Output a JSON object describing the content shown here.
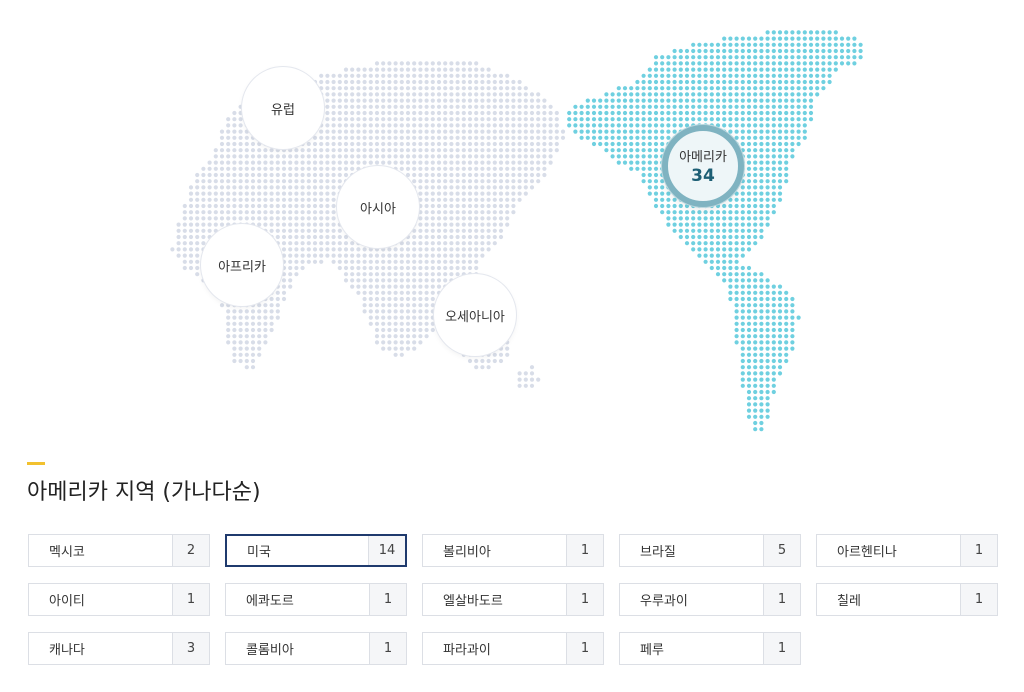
{
  "map": {
    "dot_color_inactive": "#d8dde8",
    "dot_color_active": "#6fd0e0",
    "regions": [
      {
        "id": "europe",
        "label": "유럽",
        "count": ""
      },
      {
        "id": "asia",
        "label": "아시아",
        "count": ""
      },
      {
        "id": "africa",
        "label": "아프리카",
        "count": ""
      },
      {
        "id": "oceania",
        "label": "오세아니아",
        "count": ""
      },
      {
        "id": "america",
        "label": "아메리카",
        "count": "34",
        "active": true
      }
    ]
  },
  "section": {
    "accent_color": "#f2c12e",
    "title": "아메리카 지역 (가나다순)"
  },
  "countries": [
    {
      "name": "멕시코",
      "count": "2"
    },
    {
      "name": "미국",
      "count": "14",
      "selected": true
    },
    {
      "name": "볼리비아",
      "count": "1"
    },
    {
      "name": "브라질",
      "count": "5"
    },
    {
      "name": "아르헨티나",
      "count": "1"
    },
    {
      "name": "아이티",
      "count": "1"
    },
    {
      "name": "에콰도르",
      "count": "1"
    },
    {
      "name": "엘살바도르",
      "count": "1"
    },
    {
      "name": "우루과이",
      "count": "1"
    },
    {
      "name": "칠레",
      "count": "1"
    },
    {
      "name": "캐나다",
      "count": "3"
    },
    {
      "name": "콜롬비아",
      "count": "1"
    },
    {
      "name": "파라과이",
      "count": "1"
    },
    {
      "name": "페루",
      "count": "1"
    }
  ]
}
